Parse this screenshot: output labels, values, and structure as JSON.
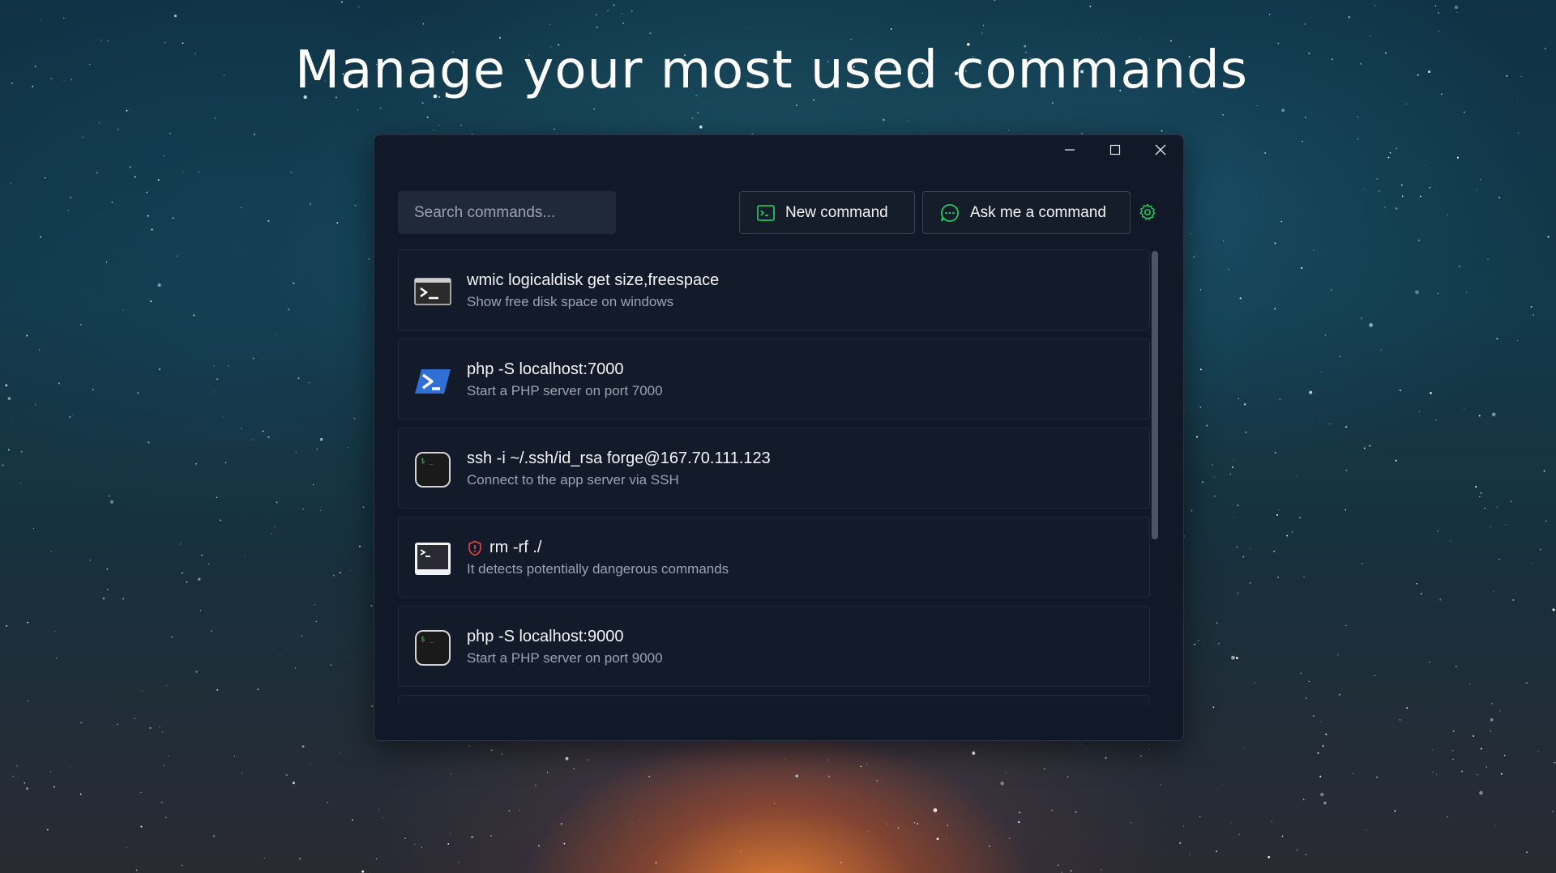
{
  "headline": "Manage your most used commands",
  "search": {
    "placeholder": "Search commands..."
  },
  "toolbar": {
    "new_label": "New command",
    "ask_label": "Ask me a command"
  },
  "accent_color": "#22c55e",
  "danger_color": "#ef4444",
  "window_controls": [
    "minimize-icon",
    "maximize-icon",
    "close-icon"
  ],
  "commands": [
    {
      "command": "wmic logicaldisk get size,freespace",
      "description": "Show free disk space on windows",
      "icon": "cmd-terminal-icon"
    },
    {
      "command": "php -S localhost:7000",
      "description": "Start a PHP server on port 7000",
      "icon": "powershell-icon"
    },
    {
      "command": "ssh -i ~/.ssh/id_rsa forge@167.70.111.123",
      "description": "Connect to the app server via SSH",
      "icon": "bash-terminal-icon"
    },
    {
      "command": "rm -rf ./",
      "description": "It detects potentially dangerous commands",
      "icon": "terminal-icon",
      "dangerous": true
    },
    {
      "command": "php -S localhost:9000",
      "description": "Start a PHP server on port 9000",
      "icon": "bash-terminal-icon"
    }
  ]
}
